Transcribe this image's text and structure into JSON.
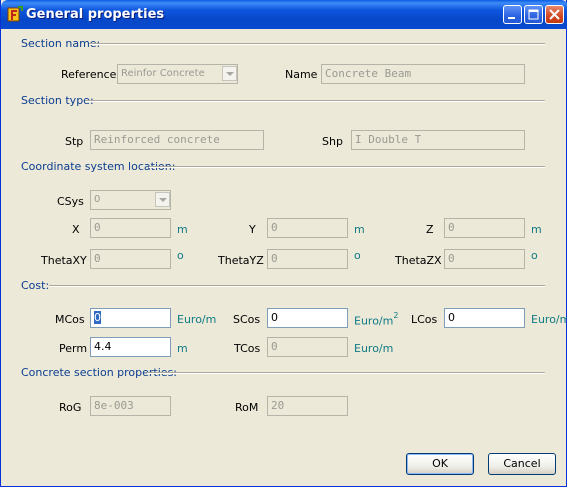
{
  "window": {
    "title": "General properties"
  },
  "sections": {
    "name": "Section name:",
    "type": "Section type:",
    "csys": "Coordinate system location:",
    "cost": "Cost:",
    "concrete": "Concrete section properties:"
  },
  "section_name": {
    "reference_label": "Reference",
    "reference_value": "Reinfor Concrete",
    "name_label": "Name",
    "name_value": "Concrete Beam"
  },
  "section_type": {
    "stp_label": "Stp",
    "stp_value": "Reinforced concrete",
    "shp_label": "Shp",
    "shp_value": "I Double T"
  },
  "coord": {
    "csys_label": "CSys",
    "csys_value": "0",
    "x_label": "X",
    "x_value": "0",
    "x_unit": "m",
    "y_label": "Y",
    "y_value": "0",
    "y_unit": "m",
    "z_label": "Z",
    "z_value": "0",
    "z_unit": "m",
    "thetaxy_label": "ThetaXY",
    "thetaxy_value": "0",
    "thetaxy_unit": "o",
    "thetayz_label": "ThetaYZ",
    "thetayz_value": "0",
    "thetayz_unit": "o",
    "thetazx_label": "ThetaZX",
    "thetazx_value": "0",
    "thetazx_unit": "o"
  },
  "cost": {
    "mcos_label": "MCos",
    "mcos_value": "0",
    "mcos_unit": "Euro/m",
    "scos_label": "SCos",
    "scos_value": "0",
    "scos_unit": "Euro/m",
    "scos_unit_exp": "2",
    "lcos_label": "LCos",
    "lcos_value": "0",
    "lcos_unit": "Euro/m",
    "perm_label": "Perm",
    "perm_value": "4.4",
    "perm_unit": "m",
    "tcos_label": "TCos",
    "tcos_value": "0",
    "tcos_unit": "Euro/m"
  },
  "concrete": {
    "rog_label": "RoG",
    "rog_value": "8e-003",
    "rom_label": "RoM",
    "rom_value": "20"
  },
  "buttons": {
    "ok": "OK",
    "cancel": "Cancel"
  }
}
